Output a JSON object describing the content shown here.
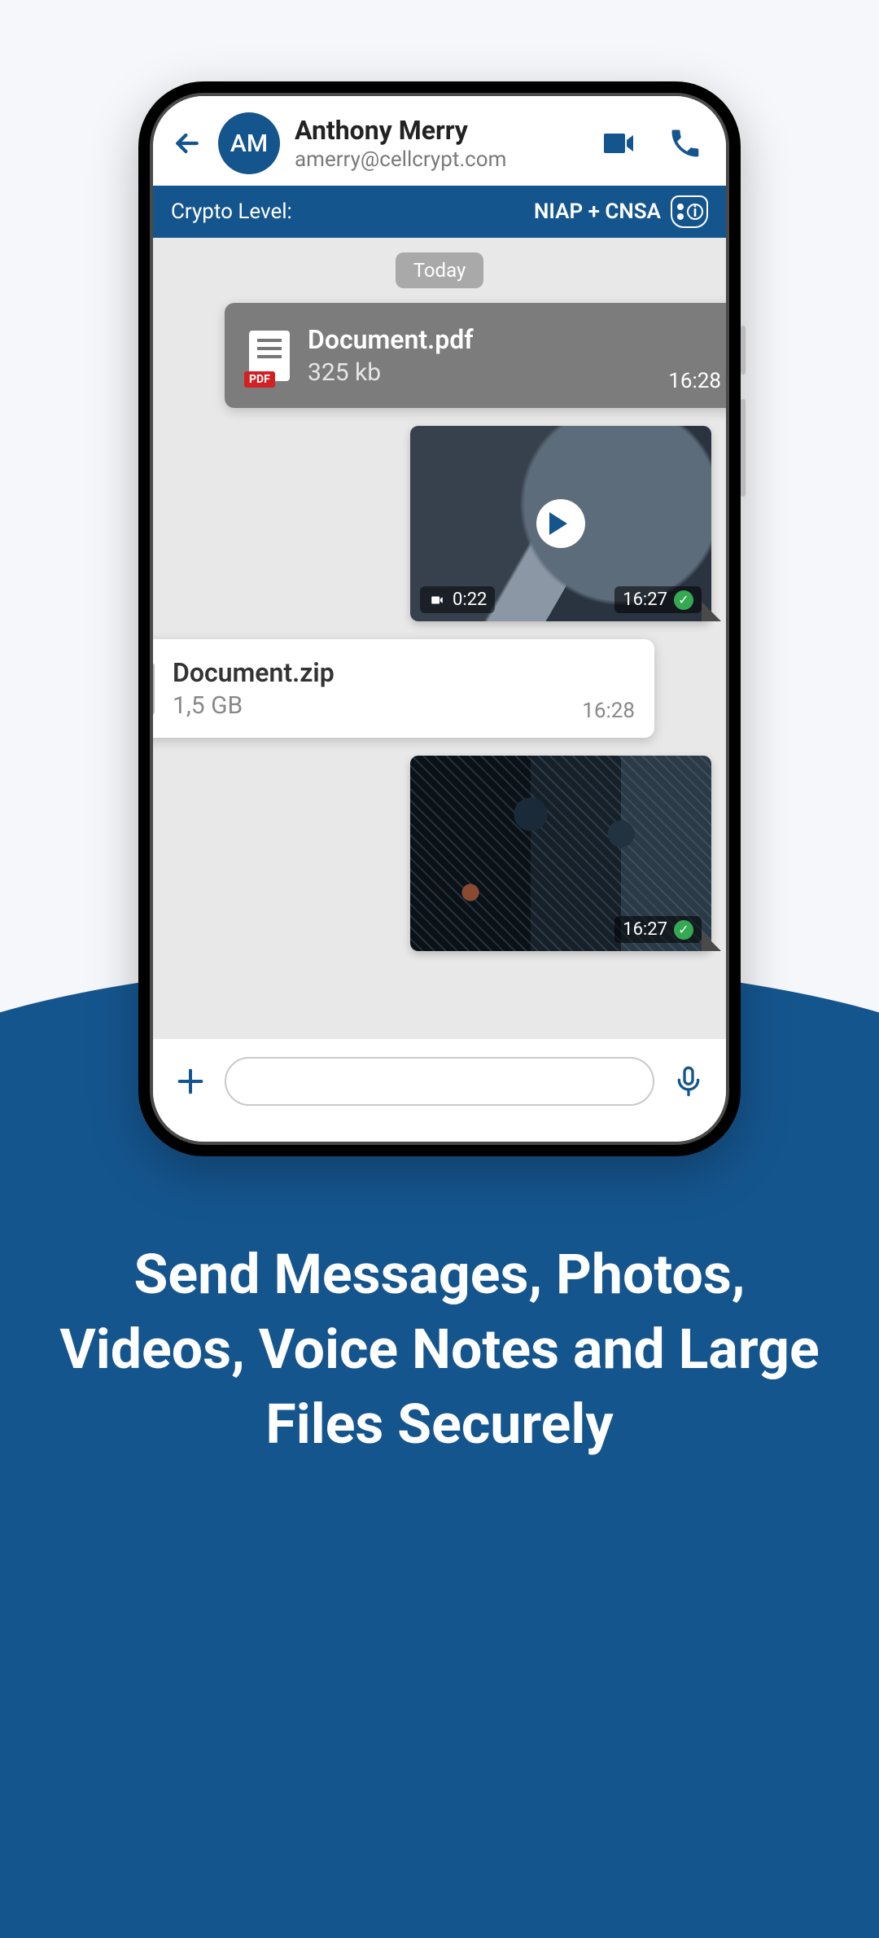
{
  "header": {
    "avatar_initials": "AM",
    "name": "Anthony Merry",
    "email": "amerry@cellcrypt.com"
  },
  "crypto": {
    "label": "Crypto Level:",
    "value": "NIAP + CNSA"
  },
  "chat": {
    "date": "Today",
    "messages": [
      {
        "dir": "out",
        "type": "file",
        "file_name": "Document.pdf",
        "file_size": "325 kb",
        "time": "16:28",
        "delivered": true
      },
      {
        "dir": "out",
        "type": "video",
        "duration": "0:22",
        "time": "16:27",
        "delivered": true
      },
      {
        "dir": "in",
        "type": "file",
        "file_name": "Document.zip",
        "file_size": "1,5 GB",
        "time": "16:28"
      },
      {
        "dir": "out",
        "type": "photo",
        "time": "16:27",
        "delivered": true
      }
    ]
  },
  "tagline": "Send Messages, Photos, Videos, Voice Notes and Large Files Securely",
  "icons": {
    "back": "back-icon",
    "video_call": "video-camera-icon",
    "voice_call": "phone-icon",
    "shield": "shield-info-icon",
    "camera_small": "camera-icon",
    "plus": "plus-icon",
    "mic": "mic-icon",
    "check": "✓"
  }
}
